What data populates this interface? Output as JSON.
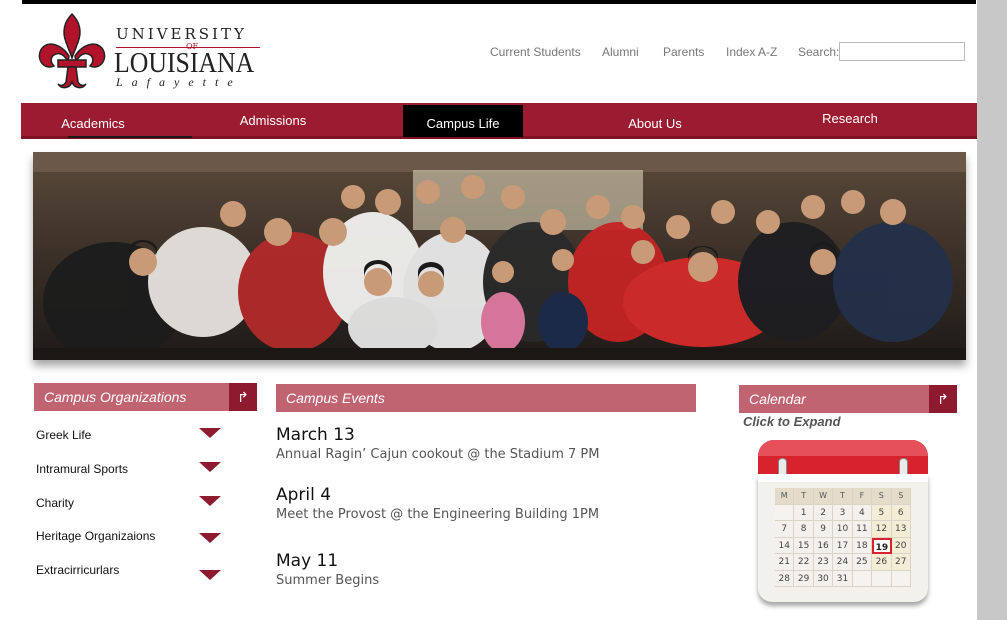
{
  "logo": {
    "line1": "UNIVERSITY",
    "of": "OF",
    "line2": "LOUISIANA",
    "line3": "Lafayette"
  },
  "toplinks": {
    "items": [
      "Current Students",
      "Alumni",
      "Parents",
      "Index A-Z"
    ],
    "search_label": "Search:",
    "search_value": ""
  },
  "nav": {
    "items": [
      "Academics",
      "Admissions",
      "Campus Life",
      "About Us",
      "Research"
    ],
    "active": "Campus Life",
    "bar_color": "#9b1b30"
  },
  "organizations": {
    "title": "Campus Organizations",
    "items": [
      "Greek Life",
      "Intramural Sports",
      "Charity",
      "Heritage Organizaions",
      "Extracirricurlars"
    ]
  },
  "events": {
    "title": "Campus Events",
    "items": [
      {
        "date": "March 13",
        "desc": "Annual Ragin’ Cajun cookout @ the Stadium 7 PM"
      },
      {
        "date": "April 4",
        "desc": "Meet the Provost @ the Engineering Building 1PM"
      },
      {
        "date": "May 11",
        "desc": "Summer Begins"
      }
    ]
  },
  "calendar": {
    "title": "Calendar",
    "hint": "Click to Expand",
    "day_headers": [
      "M",
      "T",
      "W",
      "T",
      "F",
      "S",
      "S"
    ],
    "weeks": [
      [
        "",
        "1",
        "2",
        "3",
        "4",
        "5",
        "6"
      ],
      [
        "7",
        "8",
        "9",
        "10",
        "11",
        "12",
        "13"
      ],
      [
        "14",
        "15",
        "16",
        "17",
        "18",
        "19",
        "20"
      ],
      [
        "21",
        "22",
        "23",
        "24",
        "25",
        "26",
        "27"
      ],
      [
        "28",
        "29",
        "30",
        "31",
        "",
        "",
        ""
      ]
    ],
    "today": "19"
  },
  "colors": {
    "accent": "#9b1b30",
    "header_pink": "#c06472",
    "dark_red": "#8e1a2f"
  },
  "icons": {
    "header_arrow": "return-arrow-icon",
    "expand": "triangle-down-icon"
  }
}
